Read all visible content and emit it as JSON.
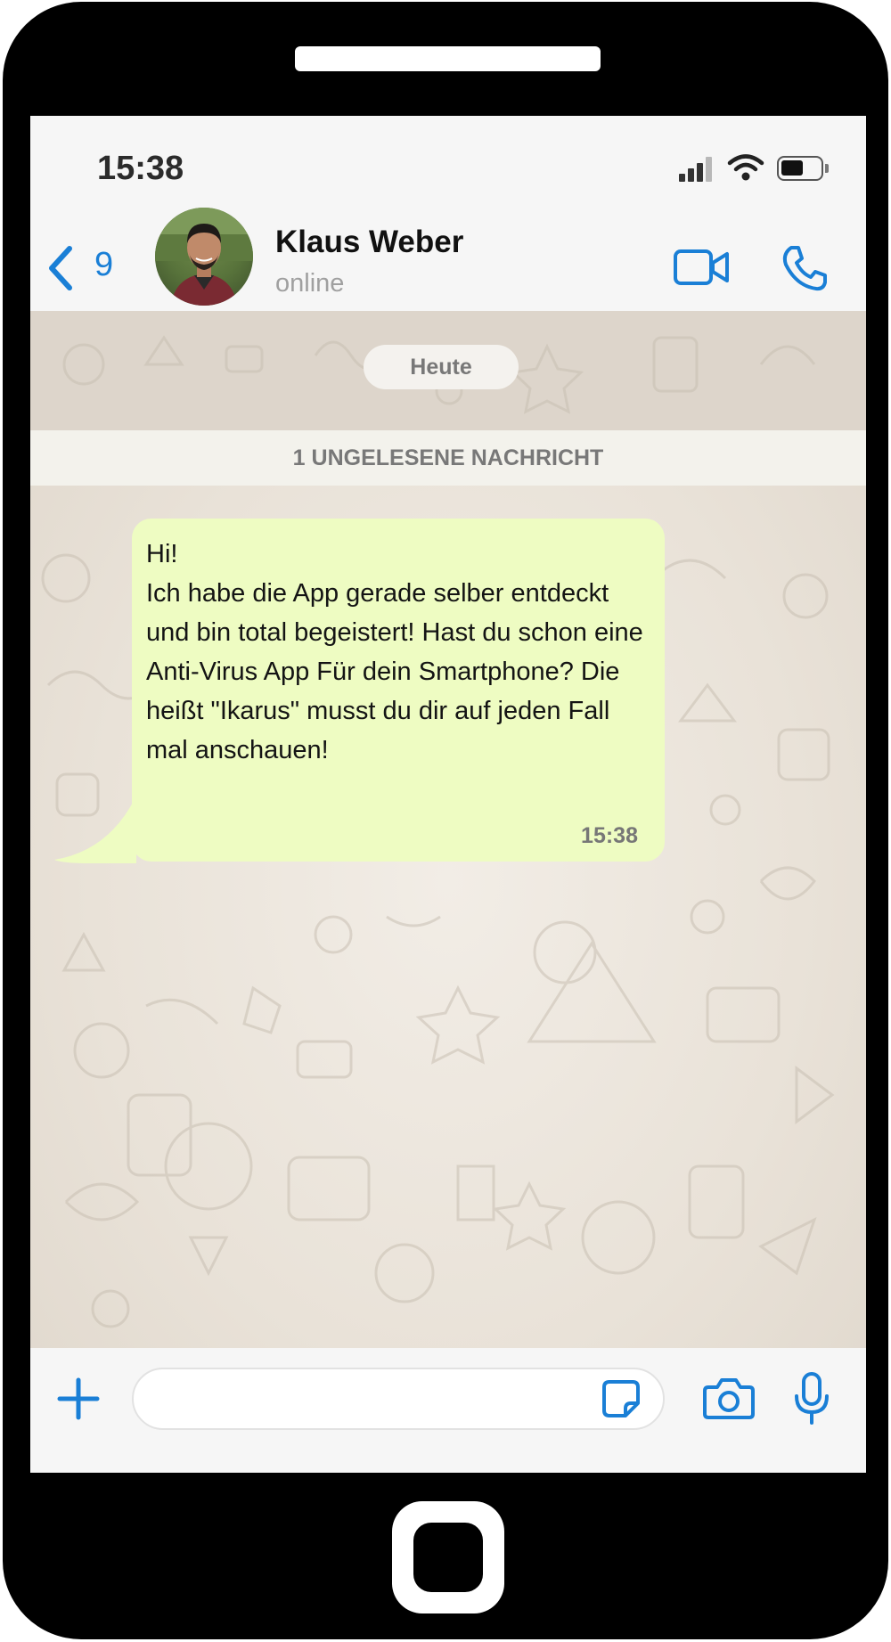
{
  "status_bar": {
    "time": "15:38",
    "icons": [
      "signal-icon",
      "wifi-icon",
      "battery-icon"
    ]
  },
  "header": {
    "back_count": "9",
    "contact_name": "Klaus Weber",
    "contact_status": "online",
    "icons": [
      "chevron-left-icon",
      "video-call-icon",
      "phone-call-icon"
    ]
  },
  "chat": {
    "date_label": "Heute",
    "unread_label": "1 UNGELESENE NACHRICHT",
    "messages": [
      {
        "text": "Hi!\nIch habe die App gerade selber entdeckt und bin total begeistert! Hast du schon eine Anti-Virus App Für dein Smartphone? Die heißt \"Ikarus\" musst du dir auf jeden Fall mal anschauen!",
        "time": "15:38"
      }
    ]
  },
  "input_bar": {
    "value": "",
    "placeholder": "",
    "icons": [
      "plus-icon",
      "sticker-icon",
      "camera-icon",
      "microphone-icon"
    ]
  },
  "colors": {
    "accent": "#1a7fd6",
    "bubble": "#eefcc2",
    "chat_background": "#e9e2d8",
    "phone_frame": "#000000"
  }
}
